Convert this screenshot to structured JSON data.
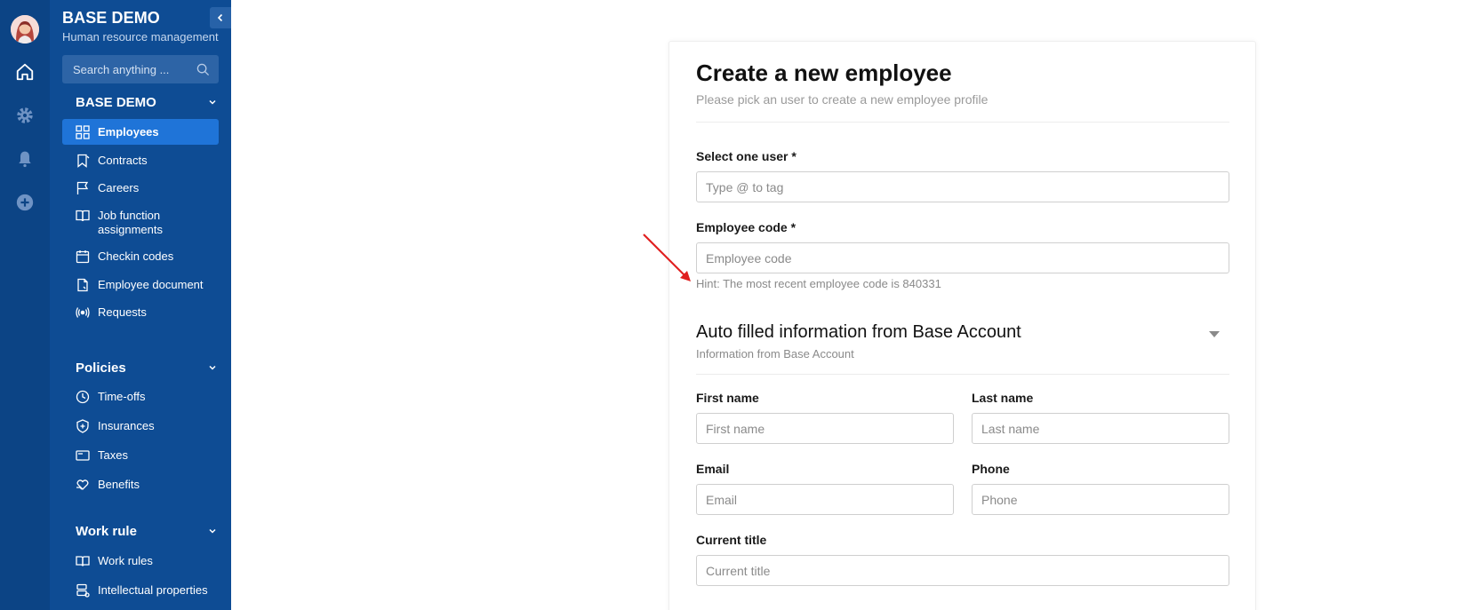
{
  "sidebar": {
    "org_name": "BASE DEMO",
    "org_subtitle": "Human resource management",
    "search_placeholder": "Search anything ...",
    "sections": [
      {
        "title": "BASE DEMO",
        "items": [
          {
            "label": "Employees",
            "icon": "grid-icon",
            "active": true
          },
          {
            "label": "Contracts",
            "icon": "document-icon"
          },
          {
            "label": "Careers",
            "icon": "flag-icon"
          },
          {
            "label": "Job function assignments",
            "icon": "book-icon"
          },
          {
            "label": "Checkin codes",
            "icon": "calendar-icon"
          },
          {
            "label": "Employee document",
            "icon": "file-icon"
          },
          {
            "label": "Requests",
            "icon": "broadcast-icon"
          }
        ]
      },
      {
        "title": "Policies",
        "items": [
          {
            "label": "Time-offs",
            "icon": "clock-icon"
          },
          {
            "label": "Insurances",
            "icon": "shield-icon"
          },
          {
            "label": "Taxes",
            "icon": "receipt-icon"
          },
          {
            "label": "Benefits",
            "icon": "heart-hand-icon"
          }
        ]
      },
      {
        "title": "Work rule",
        "items": [
          {
            "label": "Work rules",
            "icon": "open-book-icon"
          },
          {
            "label": "Intellectual properties",
            "icon": "stack-icon"
          }
        ]
      }
    ]
  },
  "form": {
    "title": "Create a new employee",
    "subtitle": "Please pick an user to create a new employee profile",
    "select_user": {
      "label": "Select one user *",
      "placeholder": "Type @ to tag"
    },
    "employee_code": {
      "label": "Employee code *",
      "placeholder": "Employee code"
    },
    "hint": "Hint: The most recent employee code is 840331",
    "auto_section": {
      "title": "Auto filled information from Base Account",
      "subtitle": "Information from Base Account"
    },
    "first_name": {
      "label": "First name",
      "placeholder": "First name"
    },
    "last_name": {
      "label": "Last name",
      "placeholder": "Last name"
    },
    "email": {
      "label": "Email",
      "placeholder": "Email"
    },
    "phone": {
      "label": "Phone",
      "placeholder": "Phone"
    },
    "current_title": {
      "label": "Current title",
      "placeholder": "Current title"
    }
  },
  "colors": {
    "rail": "#0c4485",
    "sidebar": "#0e4c94",
    "active_item": "#1f74d8",
    "annotation_arrow": "#e02020"
  }
}
